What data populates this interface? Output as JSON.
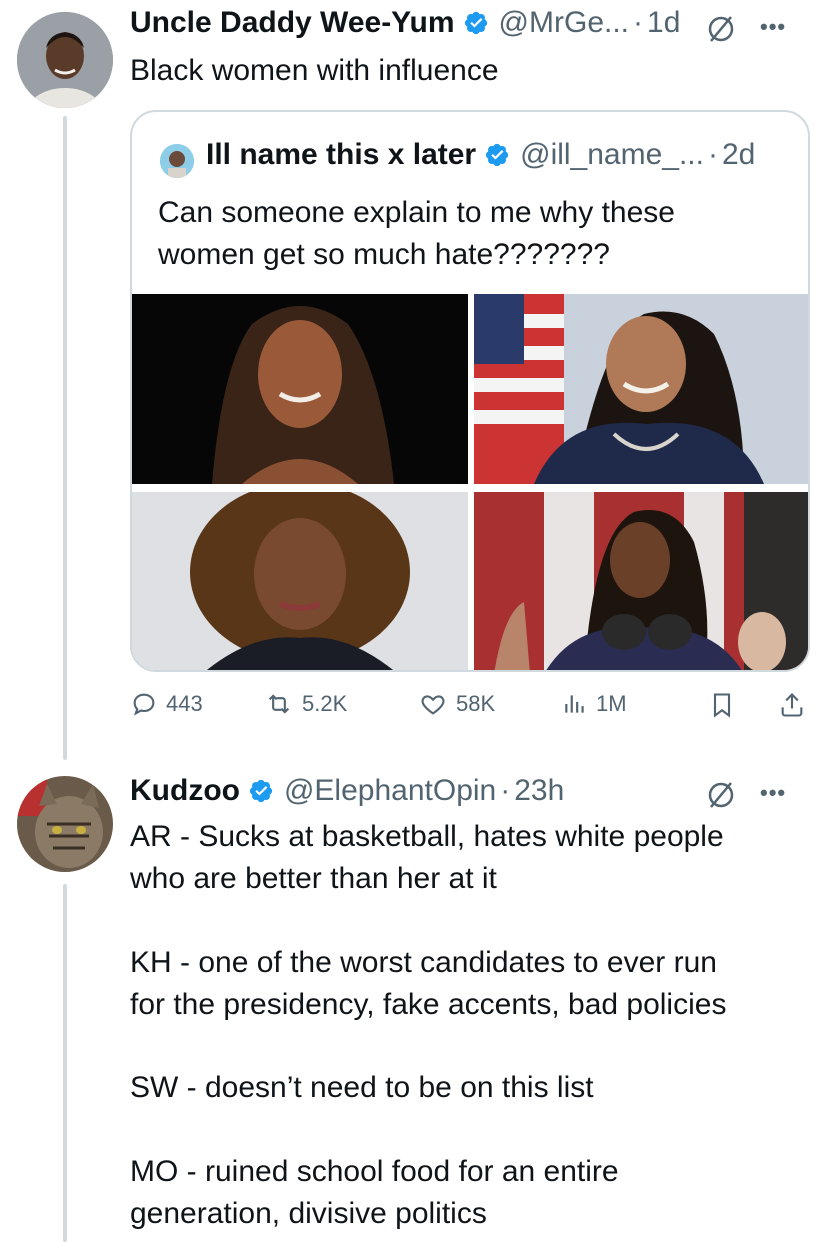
{
  "tweet": {
    "author_name": "Uncle Daddy Wee-Yum",
    "handle": "@MrGe...",
    "separator": "·",
    "time": "1d",
    "text": "Black women with influence"
  },
  "quote": {
    "author_name": "Ill name this x later",
    "handle": "@ill_name_...",
    "separator": "·",
    "time": "2d",
    "text_line1": "Can someone explain to me why these",
    "text_line2": "women get so much hate???????"
  },
  "stats": {
    "replies": "443",
    "reposts": "5.2K",
    "likes": "58K",
    "views": "1M"
  },
  "reply": {
    "author_name": "Kudzoo",
    "handle": "@ElephantOpin",
    "separator": "·",
    "time": "23h",
    "lines": [
      "AR - Sucks at basketball, hates white people",
      "who are better than her at it",
      "KH - one of the worst candidates to ever run",
      "for the presidency, fake accents, bad policies",
      "SW - doesn’t need to be on this list",
      "MO - ruined school food for an entire",
      "generation, divisive politics"
    ]
  },
  "icons": {
    "verified": "verified-badge-icon",
    "grok": "grok-icon",
    "more": "more-icon",
    "reply": "reply-icon",
    "repost": "repost-icon",
    "like": "like-icon",
    "views": "views-icon",
    "bookmark": "bookmark-icon",
    "share": "share-icon"
  },
  "colors": {
    "verified": "#1d9bf0",
    "text": "#0f1419",
    "secondary": "#536471",
    "border": "#cfd9de"
  }
}
